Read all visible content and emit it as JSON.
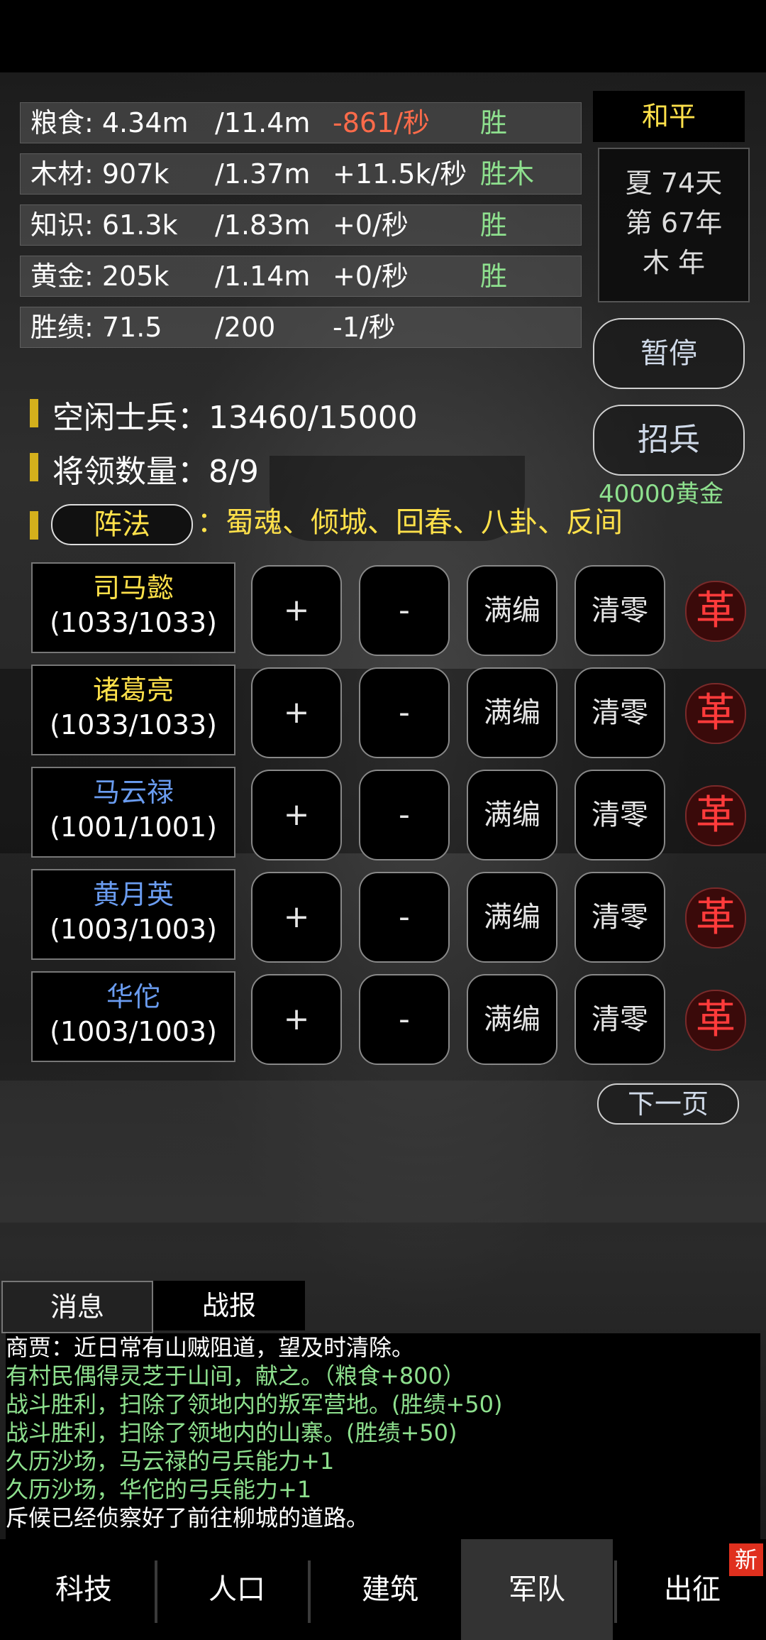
{
  "resources": [
    {
      "name": "粮食: 4.34m",
      "cap": "/11.4m",
      "rate": "-861/秒",
      "rate_color": "#ff6b4a",
      "win": "胜"
    },
    {
      "name": "木材: 907k",
      "cap": "/1.37m",
      "rate": "+11.5k/秒",
      "rate_color": "#ffffff",
      "win": "胜木"
    },
    {
      "name": "知识: 61.3k",
      "cap": "/1.83m",
      "rate": "+0/秒",
      "rate_color": "#ffffff",
      "win": "胜"
    },
    {
      "name": "黄金: 205k",
      "cap": "/1.14m",
      "rate": "+0/秒",
      "rate_color": "#ffffff",
      "win": "胜"
    },
    {
      "name": "胜绩: 71.5",
      "cap": "/200",
      "rate": "-1/秒",
      "rate_color": "#ffffff",
      "win": ""
    }
  ],
  "status": "和平",
  "date": {
    "season": "夏 74天",
    "year": "第 67年",
    "element": "木 年"
  },
  "buttons": {
    "pause": "暂停",
    "recruit": "招兵",
    "recruit_cost": "40000黄金",
    "next_page": "下一页"
  },
  "army": {
    "idle_label": "空闲士兵：",
    "idle_value": "13460/15000",
    "generals_label": "将领数量：",
    "generals_value": "8/9",
    "formation_button": "阵法",
    "formation_list": "：蜀魂、倾城、回春、八卦、反间"
  },
  "generals": [
    {
      "name": "司马懿",
      "count": "(1033/1033)",
      "color": "#ffe14a"
    },
    {
      "name": "诸葛亮",
      "count": "(1033/1033)",
      "color": "#ffe14a"
    },
    {
      "name": "马云禄",
      "count": "(1001/1001)",
      "color": "#6a9cf0"
    },
    {
      "name": "黄月英",
      "count": "(1003/1003)",
      "color": "#6a9cf0"
    },
    {
      "name": "华佗",
      "count": "(1003/1003)",
      "color": "#6a9cf0"
    }
  ],
  "general_actions": {
    "plus": "+",
    "minus": "-",
    "full": "满编",
    "clear": "清零",
    "dismiss": "革"
  },
  "tabs": [
    "消息",
    "战报"
  ],
  "log": [
    {
      "text": "商贾：近日常有山贼阻道，望及时清除。",
      "color": "#ffffff"
    },
    {
      "text": "有村民偶得灵芝于山间，献之。（粮食+800）",
      "color": "#8ee08e"
    },
    {
      "text": "战斗胜利，扫除了领地内的叛军营地。(胜绩+50)",
      "color": "#8ee08e"
    },
    {
      "text": "战斗胜利，扫除了领地内的山寨。(胜绩+50)",
      "color": "#8ee08e"
    },
    {
      "text": "久历沙场，马云禄的弓兵能力+1",
      "color": "#8ee08e"
    },
    {
      "text": "久历沙场，华佗的弓兵能力+1",
      "color": "#8ee08e"
    },
    {
      "text": "斥候已经侦察好了前往柳城的道路。",
      "color": "#ffffff"
    }
  ],
  "nav": [
    "科技",
    "人口",
    "建筑",
    "军队",
    "出征"
  ],
  "nav_badge": "新"
}
